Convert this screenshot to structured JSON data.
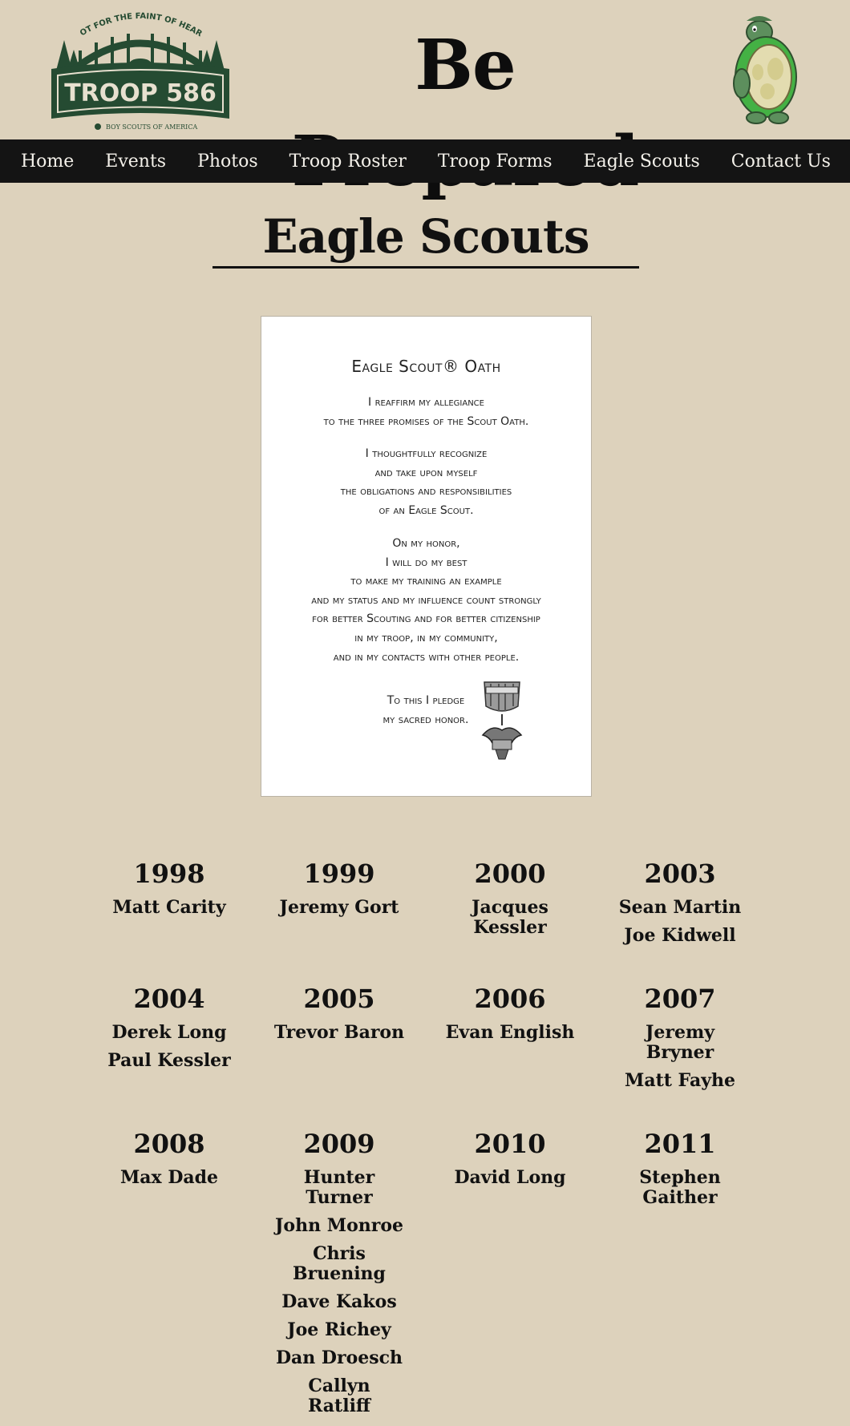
{
  "header": {
    "logo": {
      "arc_text": "NOT FOR THE FAINT OF HEART",
      "troop_text": "TROOP 586",
      "bsa_text": "BOY SCOUTS OF AMERICA"
    },
    "headline": "Be Prepared",
    "mascot_icon": "turtle-mascot-icon"
  },
  "nav": {
    "items": [
      "Home",
      "Events",
      "Photos",
      "Troop Roster",
      "Troop Forms",
      "Eagle Scouts",
      "Contact Us"
    ]
  },
  "page": {
    "title": "Eagle Scouts"
  },
  "oath": {
    "title": "Eagle Scout® Oath",
    "stanza1": [
      "I reaffirm my allegiance",
      "to the three promises of the Scout Oath."
    ],
    "stanza2": [
      "I thoughtfully recognize",
      "and take upon myself",
      "the obligations and responsibilities",
      "of an Eagle Scout."
    ],
    "stanza3": [
      "On my honor,",
      "I will do my best",
      "to make my training an example",
      "and my status and my influence count strongly",
      "for better Scouting and for better citizenship",
      "in my troop, in my community,",
      "and in my contacts with other people."
    ],
    "pledge": [
      "To this I pledge",
      "my sacred honor."
    ],
    "medal_icon": "eagle-medal-icon"
  },
  "eagle_scouts": [
    {
      "year": "1998",
      "names": [
        "Matt Carity"
      ]
    },
    {
      "year": "1999",
      "names": [
        "Jeremy Gort"
      ]
    },
    {
      "year": "2000",
      "names": [
        "Jacques Kessler"
      ]
    },
    {
      "year": "2003",
      "names": [
        "Sean Martin",
        "Joe Kidwell"
      ]
    },
    {
      "year": "2004",
      "names": [
        "Derek Long",
        "Paul Kessler"
      ]
    },
    {
      "year": "2005",
      "names": [
        "Trevor Baron"
      ]
    },
    {
      "year": "2006",
      "names": [
        "Evan English"
      ]
    },
    {
      "year": "2007",
      "names": [
        "Jeremy Bryner",
        "Matt Fayhe"
      ]
    },
    {
      "year": "2008",
      "names": [
        "Max Dade"
      ]
    },
    {
      "year": "2009",
      "names": [
        "Hunter Turner",
        "John Monroe",
        "Chris Bruening",
        "Dave Kakos",
        "Joe Richey",
        "Dan Droesch",
        "Callyn Ratliff"
      ]
    },
    {
      "year": "2010",
      "names": [
        "David Long"
      ]
    },
    {
      "year": "2011",
      "names": [
        "Stephen Gaither"
      ]
    }
  ],
  "colors": {
    "background": "#ddd2bc",
    "nav_bg": "#141414",
    "logo_green": "#254b32",
    "turtle_green": "#5d8f5d"
  }
}
